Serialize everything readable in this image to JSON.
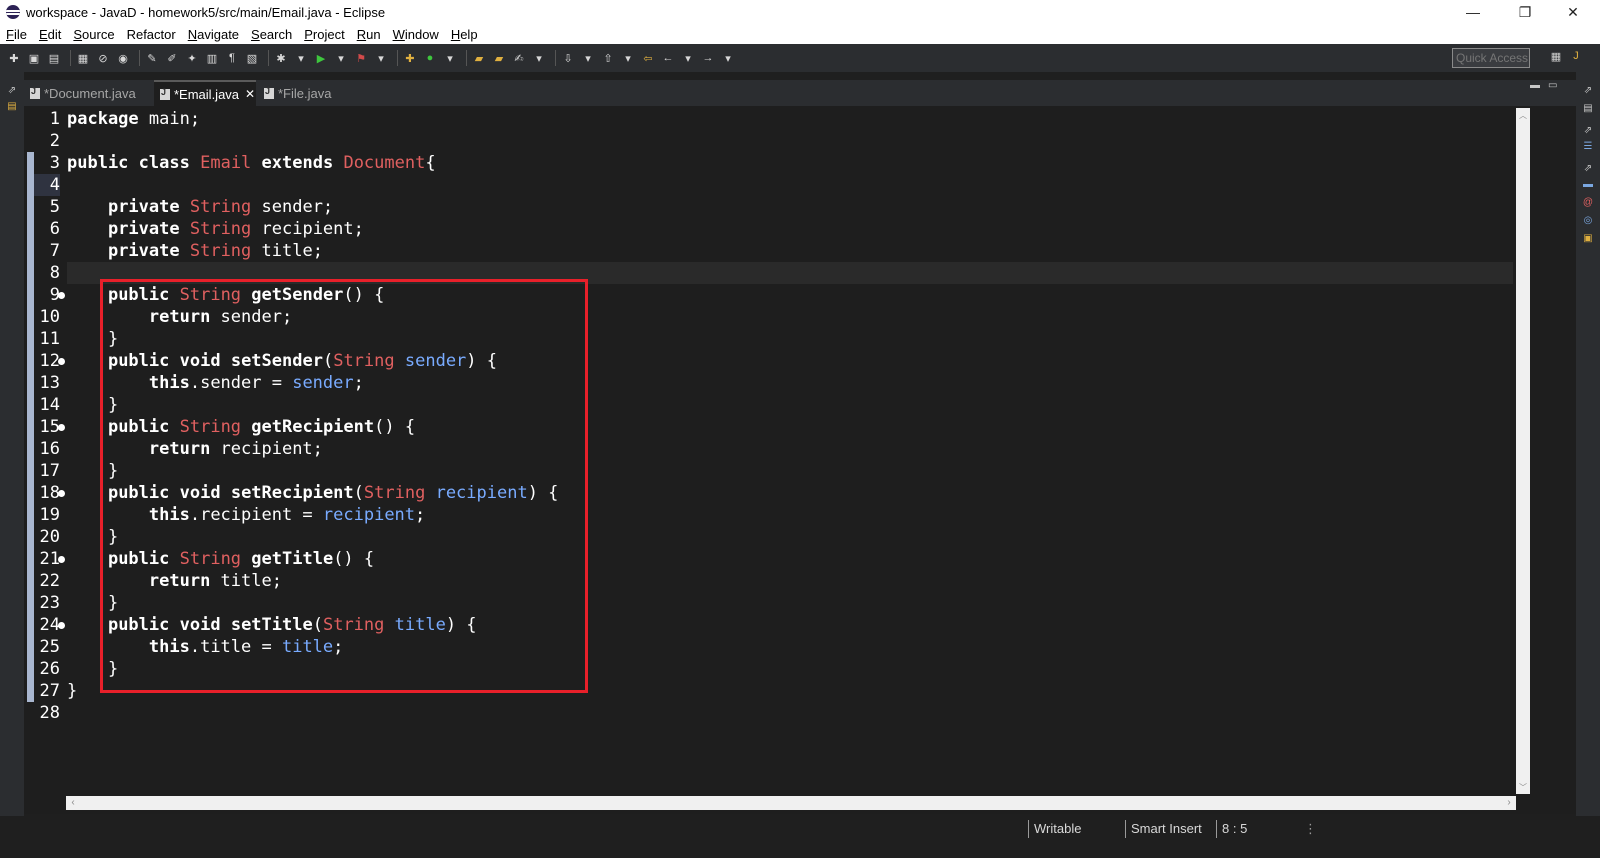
{
  "window": {
    "title": "workspace - JavaD - homework5/src/main/Email.java - Eclipse",
    "minimize": "—",
    "maximize": "❐",
    "close": "✕"
  },
  "menu": [
    {
      "label": "File",
      "u": "F",
      "rest": "ile"
    },
    {
      "label": "Edit",
      "u": "E",
      "rest": "dit"
    },
    {
      "label": "Source",
      "u": "S",
      "rest": "ource"
    },
    {
      "label": "Refactor",
      "u": "",
      "rest": "Refactor"
    },
    {
      "label": "Navigate",
      "u": "N",
      "rest": "avigate"
    },
    {
      "label": "Search",
      "u": "S",
      "rest": "earch"
    },
    {
      "label": "Project",
      "u": "P",
      "rest": "roject"
    },
    {
      "label": "Run",
      "u": "R",
      "rest": "un"
    },
    {
      "label": "Window",
      "u": "W",
      "rest": "indow"
    },
    {
      "label": "Help",
      "u": "H",
      "rest": "elp"
    }
  ],
  "toolbar": {
    "quick_access_placeholder": "Quick Access"
  },
  "tabs": [
    {
      "label": "*Document.java",
      "active": false
    },
    {
      "label": "*Email.java",
      "active": true,
      "close": "✕"
    },
    {
      "label": "*File.java",
      "active": false
    }
  ],
  "editor": {
    "current_line": 4,
    "line_numbers": [
      "1",
      "2",
      "3",
      "4",
      "5",
      "6",
      "7",
      "8",
      "9",
      "10",
      "11",
      "12",
      "13",
      "14",
      "15",
      "16",
      "17",
      "18",
      "19",
      "20",
      "21",
      "22",
      "23",
      "24",
      "25",
      "26",
      "27",
      "28"
    ],
    "fold_markers": [
      "9",
      "12",
      "15",
      "18",
      "21",
      "24"
    ],
    "lines": [
      [
        {
          "t": "package",
          "c": "kw"
        },
        {
          "t": " main;",
          "c": "pl"
        }
      ],
      [],
      [
        {
          "t": "public",
          "c": "kw"
        },
        {
          "t": " ",
          "c": "pl"
        },
        {
          "t": "class",
          "c": "kw"
        },
        {
          "t": " ",
          "c": "pl"
        },
        {
          "t": "Email",
          "c": "ty"
        },
        {
          "t": " ",
          "c": "pl"
        },
        {
          "t": "extends",
          "c": "kw"
        },
        {
          "t": " ",
          "c": "pl"
        },
        {
          "t": "Document",
          "c": "ty"
        },
        {
          "t": "{",
          "c": "pl"
        }
      ],
      [],
      [
        {
          "t": "    ",
          "c": "pl"
        },
        {
          "t": "private",
          "c": "kw"
        },
        {
          "t": " ",
          "c": "pl"
        },
        {
          "t": "String",
          "c": "ty"
        },
        {
          "t": " sender;",
          "c": "pl"
        }
      ],
      [
        {
          "t": "    ",
          "c": "pl"
        },
        {
          "t": "private",
          "c": "kw"
        },
        {
          "t": " ",
          "c": "pl"
        },
        {
          "t": "String",
          "c": "ty"
        },
        {
          "t": " recipient;",
          "c": "pl"
        }
      ],
      [
        {
          "t": "    ",
          "c": "pl"
        },
        {
          "t": "private",
          "c": "kw"
        },
        {
          "t": " ",
          "c": "pl"
        },
        {
          "t": "String",
          "c": "ty"
        },
        {
          "t": " title;",
          "c": "pl"
        }
      ],
      [],
      [
        {
          "t": "    ",
          "c": "pl"
        },
        {
          "t": "public",
          "c": "kw"
        },
        {
          "t": " ",
          "c": "pl"
        },
        {
          "t": "String",
          "c": "ty"
        },
        {
          "t": " ",
          "c": "pl"
        },
        {
          "t": "getSender",
          "c": "fn"
        },
        {
          "t": "() {",
          "c": "pl"
        }
      ],
      [
        {
          "t": "        ",
          "c": "pl"
        },
        {
          "t": "return",
          "c": "kw"
        },
        {
          "t": " sender;",
          "c": "pl"
        }
      ],
      [
        {
          "t": "    }",
          "c": "pl"
        }
      ],
      [
        {
          "t": "    ",
          "c": "pl"
        },
        {
          "t": "public",
          "c": "kw"
        },
        {
          "t": " ",
          "c": "pl"
        },
        {
          "t": "void",
          "c": "kw"
        },
        {
          "t": " ",
          "c": "pl"
        },
        {
          "t": "setSender",
          "c": "fn"
        },
        {
          "t": "(",
          "c": "pl"
        },
        {
          "t": "String",
          "c": "ty"
        },
        {
          "t": " ",
          "c": "pl"
        },
        {
          "t": "sender",
          "c": "prm"
        },
        {
          "t": ") {",
          "c": "pl"
        }
      ],
      [
        {
          "t": "        ",
          "c": "pl"
        },
        {
          "t": "this",
          "c": "kw"
        },
        {
          "t": ".sender = ",
          "c": "pl"
        },
        {
          "t": "sender",
          "c": "prm"
        },
        {
          "t": ";",
          "c": "pl"
        }
      ],
      [
        {
          "t": "    }",
          "c": "pl"
        }
      ],
      [
        {
          "t": "    ",
          "c": "pl"
        },
        {
          "t": "public",
          "c": "kw"
        },
        {
          "t": " ",
          "c": "pl"
        },
        {
          "t": "String",
          "c": "ty"
        },
        {
          "t": " ",
          "c": "pl"
        },
        {
          "t": "getRecipient",
          "c": "fn"
        },
        {
          "t": "() {",
          "c": "pl"
        }
      ],
      [
        {
          "t": "        ",
          "c": "pl"
        },
        {
          "t": "return",
          "c": "kw"
        },
        {
          "t": " recipient;",
          "c": "pl"
        }
      ],
      [
        {
          "t": "    }",
          "c": "pl"
        }
      ],
      [
        {
          "t": "    ",
          "c": "pl"
        },
        {
          "t": "public",
          "c": "kw"
        },
        {
          "t": " ",
          "c": "pl"
        },
        {
          "t": "void",
          "c": "kw"
        },
        {
          "t": " ",
          "c": "pl"
        },
        {
          "t": "setRecipient",
          "c": "fn"
        },
        {
          "t": "(",
          "c": "pl"
        },
        {
          "t": "String",
          "c": "ty"
        },
        {
          "t": " ",
          "c": "pl"
        },
        {
          "t": "recipient",
          "c": "prm"
        },
        {
          "t": ") {",
          "c": "pl"
        }
      ],
      [
        {
          "t": "        ",
          "c": "pl"
        },
        {
          "t": "this",
          "c": "kw"
        },
        {
          "t": ".recipient = ",
          "c": "pl"
        },
        {
          "t": "recipient",
          "c": "prm"
        },
        {
          "t": ";",
          "c": "pl"
        }
      ],
      [
        {
          "t": "    }",
          "c": "pl"
        }
      ],
      [
        {
          "t": "    ",
          "c": "pl"
        },
        {
          "t": "public",
          "c": "kw"
        },
        {
          "t": " ",
          "c": "pl"
        },
        {
          "t": "String",
          "c": "ty"
        },
        {
          "t": " ",
          "c": "pl"
        },
        {
          "t": "getTitle",
          "c": "fn"
        },
        {
          "t": "() {",
          "c": "pl"
        }
      ],
      [
        {
          "t": "        ",
          "c": "pl"
        },
        {
          "t": "return",
          "c": "kw"
        },
        {
          "t": " title;",
          "c": "pl"
        }
      ],
      [
        {
          "t": "    }",
          "c": "pl"
        }
      ],
      [
        {
          "t": "    ",
          "c": "pl"
        },
        {
          "t": "public",
          "c": "kw"
        },
        {
          "t": " ",
          "c": "pl"
        },
        {
          "t": "void",
          "c": "kw"
        },
        {
          "t": " ",
          "c": "pl"
        },
        {
          "t": "setTitle",
          "c": "fn"
        },
        {
          "t": "(",
          "c": "pl"
        },
        {
          "t": "String",
          "c": "ty"
        },
        {
          "t": " ",
          "c": "pl"
        },
        {
          "t": "title",
          "c": "prm"
        },
        {
          "t": ") {",
          "c": "pl"
        }
      ],
      [
        {
          "t": "        ",
          "c": "pl"
        },
        {
          "t": "this",
          "c": "kw"
        },
        {
          "t": ".title = ",
          "c": "pl"
        },
        {
          "t": "title",
          "c": "prm"
        },
        {
          "t": ";",
          "c": "pl"
        }
      ],
      [
        {
          "t": "    }",
          "c": "pl"
        }
      ],
      [
        {
          "t": "}",
          "c": "pl"
        }
      ],
      []
    ]
  },
  "status": {
    "writable": "Writable",
    "insert_mode": "Smart Insert",
    "position": "8 : 5"
  },
  "colors": {
    "highlight_box": "#e8202a",
    "type": "#e06060",
    "parameter": "#79abff"
  }
}
